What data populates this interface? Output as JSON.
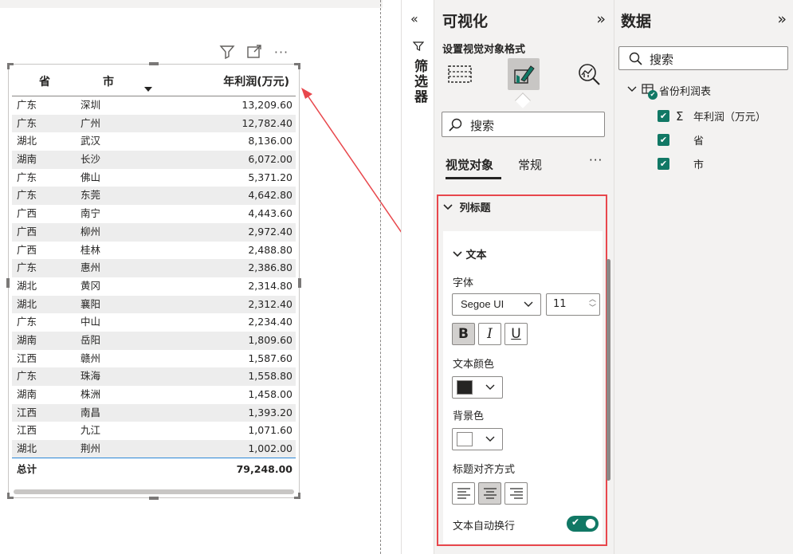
{
  "table": {
    "columns": [
      "省",
      "市",
      "年利润(万元)"
    ],
    "rows": [
      [
        "广东",
        "深圳",
        "13,209.60"
      ],
      [
        "广东",
        "广州",
        "12,782.40"
      ],
      [
        "湖北",
        "武汉",
        "8,136.00"
      ],
      [
        "湖南",
        "长沙",
        "6,072.00"
      ],
      [
        "广东",
        "佛山",
        "5,371.20"
      ],
      [
        "广东",
        "东莞",
        "4,642.80"
      ],
      [
        "广西",
        "南宁",
        "4,443.60"
      ],
      [
        "广西",
        "柳州",
        "2,972.40"
      ],
      [
        "广西",
        "桂林",
        "2,488.80"
      ],
      [
        "广东",
        "惠州",
        "2,386.80"
      ],
      [
        "湖北",
        "黄冈",
        "2,314.80"
      ],
      [
        "湖北",
        "襄阳",
        "2,312.40"
      ],
      [
        "广东",
        "中山",
        "2,234.40"
      ],
      [
        "湖南",
        "岳阳",
        "1,809.60"
      ],
      [
        "江西",
        "赣州",
        "1,587.60"
      ],
      [
        "广东",
        "珠海",
        "1,558.80"
      ],
      [
        "湖南",
        "株洲",
        "1,458.00"
      ],
      [
        "江西",
        "南昌",
        "1,393.20"
      ],
      [
        "江西",
        "九江",
        "1,071.60"
      ],
      [
        "湖北",
        "荆州",
        "1,002.00"
      ]
    ],
    "total_label": "总计",
    "total_value": "79,248.00"
  },
  "visual_header": {
    "icons": [
      "filter-icon",
      "focus-mode-icon",
      "more-options-icon"
    ],
    "more": "···"
  },
  "filters": {
    "collapse": "«",
    "title": "筛选器"
  },
  "viz": {
    "title": "可视化",
    "expand": "»",
    "subtitle": "设置视觉对象格式",
    "search_placeholder": "搜索",
    "tabs": [
      "视觉对象",
      "常规"
    ],
    "more": "···",
    "section_title": "列标题",
    "card_title": "文本",
    "font_label": "字体",
    "font_family": "Segoe UI",
    "font_size": "11",
    "bold": "B",
    "italic": "I",
    "underline": "U",
    "text_color_label": "文本颜色",
    "text_color": "#252423",
    "bg_color_label": "背景色",
    "bg_color": "#ffffff",
    "align_label": "标题对齐方式",
    "wrap_label": "文本自动换行",
    "wrap_on": true
  },
  "data": {
    "title": "数据",
    "expand": "»",
    "search_placeholder": "搜索",
    "table_name": "省份利润表",
    "fields": [
      {
        "name": "年利润（万元）",
        "kind": "sum"
      },
      {
        "name": "省",
        "kind": "text"
      },
      {
        "name": "市",
        "kind": "text"
      }
    ]
  },
  "colors": {
    "accent": "#117865",
    "highlight": "#e8474c"
  }
}
